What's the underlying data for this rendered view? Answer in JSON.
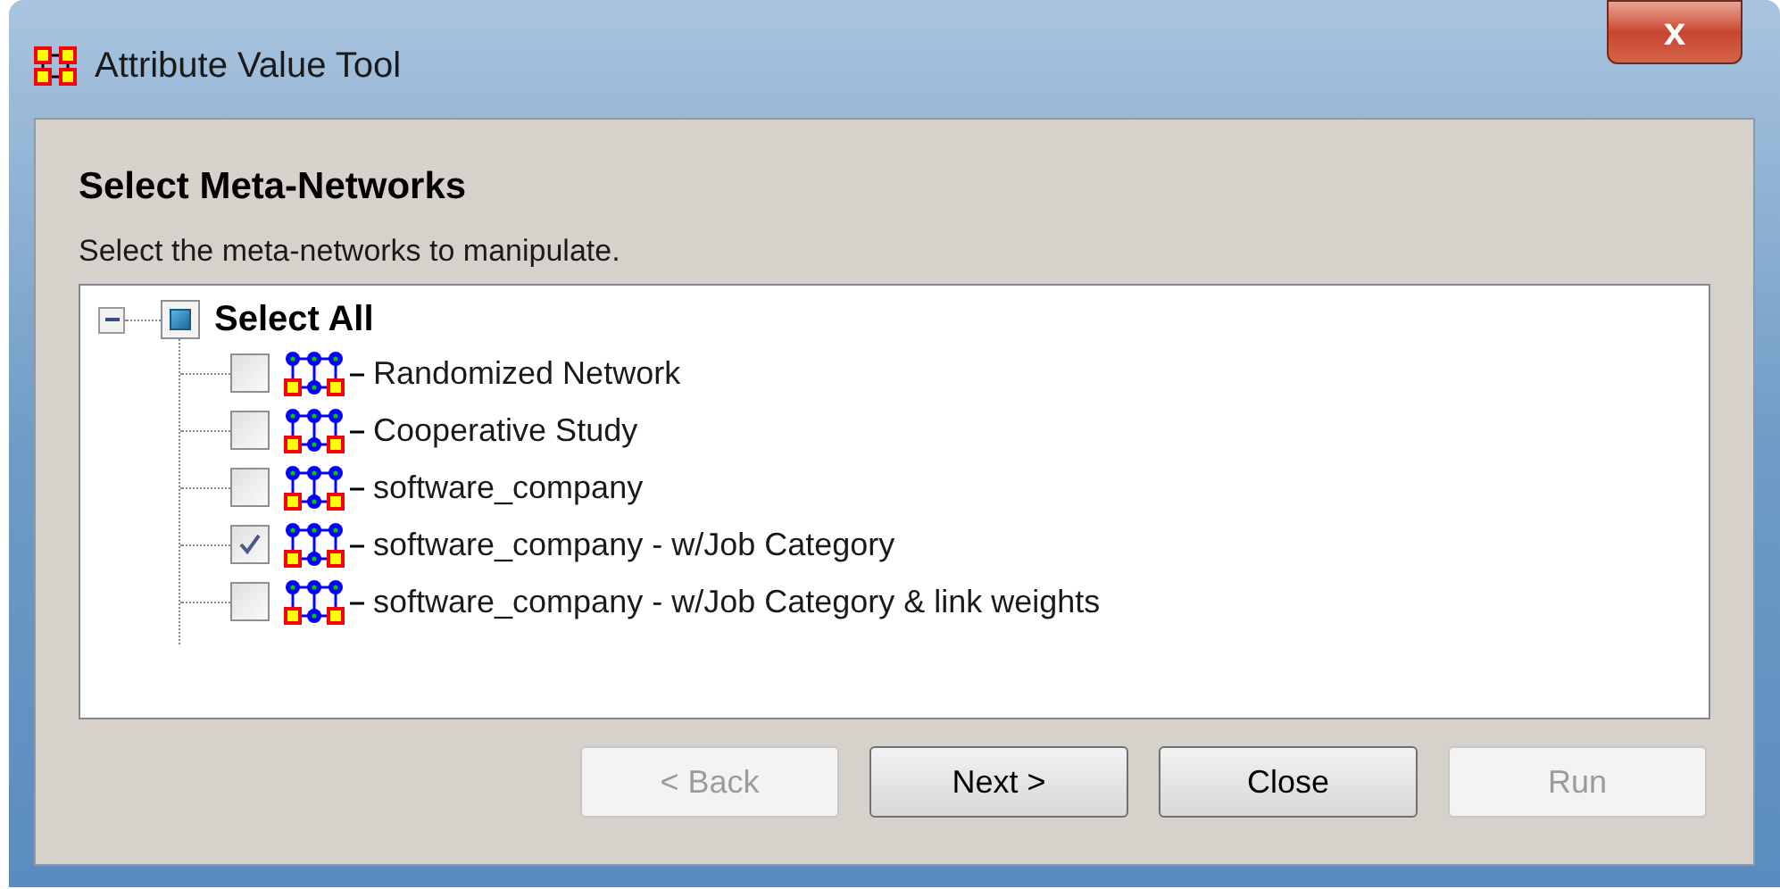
{
  "window": {
    "title": "Attribute Value Tool",
    "close_label": "x"
  },
  "heading": "Select Meta-Networks",
  "instruction": "Select the meta-networks to manipulate.",
  "tree": {
    "label": "Select All",
    "expanded": true,
    "indeterminate": true,
    "children": [
      {
        "label": "Randomized Network",
        "checked": false
      },
      {
        "label": "Cooperative Study",
        "checked": false
      },
      {
        "label": "software_company",
        "checked": false
      },
      {
        "label": "software_company - w/Job Category",
        "checked": true
      },
      {
        "label": "software_company - w/Job Category & link weights",
        "checked": false
      }
    ]
  },
  "buttons": [
    {
      "label": "< Back",
      "disabled": true
    },
    {
      "label": "Next >",
      "disabled": false
    },
    {
      "label": "Close",
      "disabled": false
    },
    {
      "label": "Run",
      "disabled": true
    }
  ]
}
